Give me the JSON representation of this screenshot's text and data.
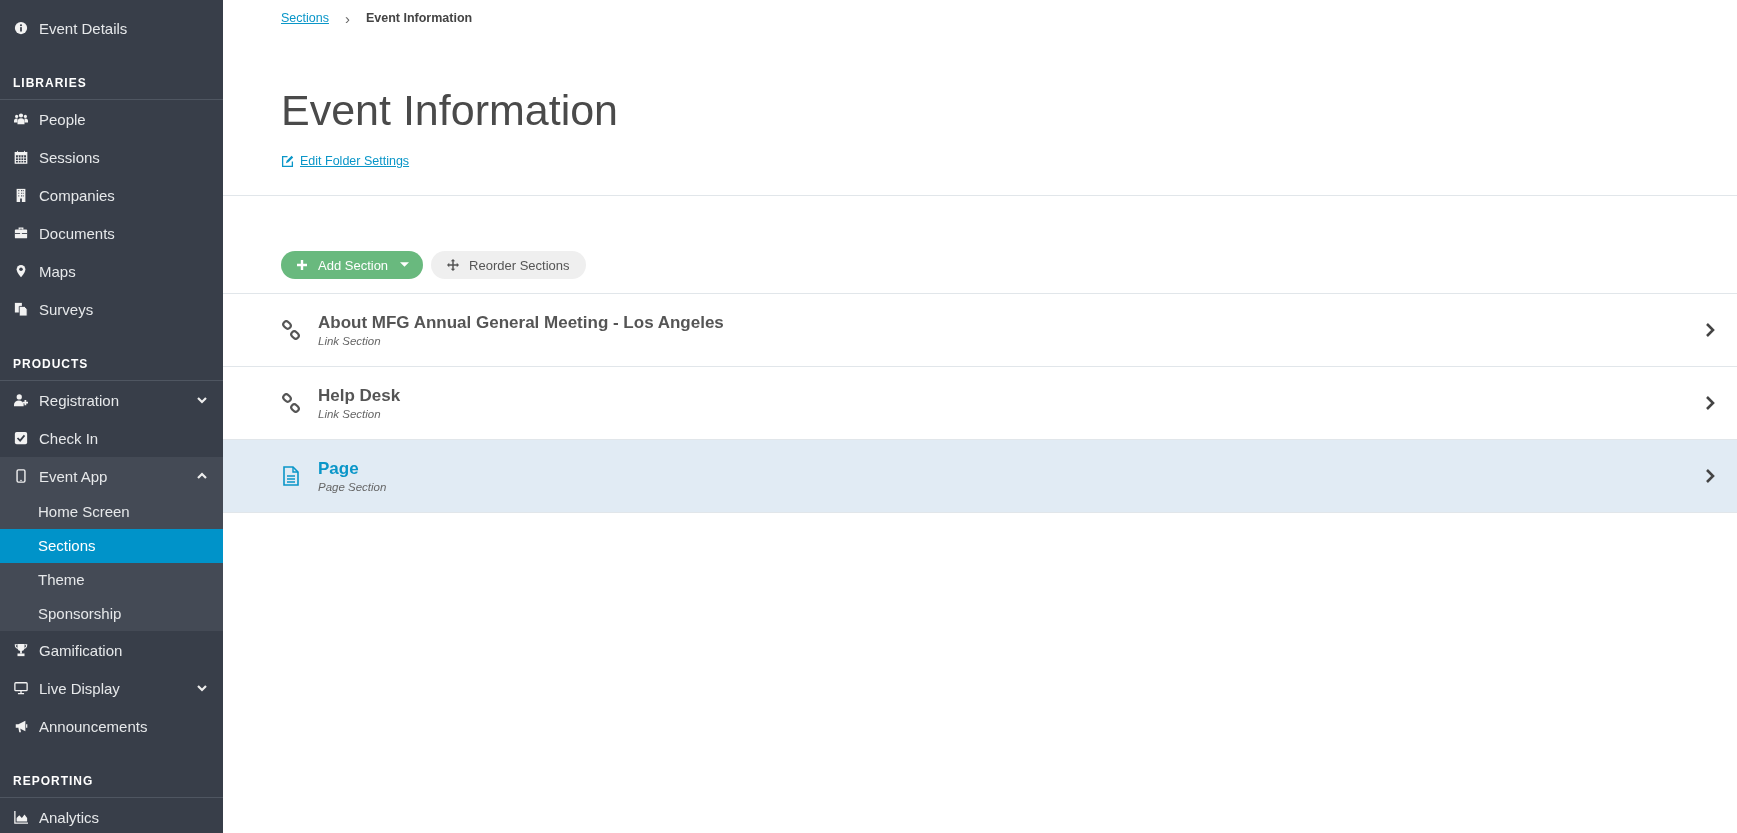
{
  "sidebar": {
    "groups": [
      {
        "items": [
          {
            "label": "Event Details",
            "selected": false
          }
        ]
      },
      {
        "header": "LIBRARIES",
        "items": [
          {
            "label": "People",
            "selected": false
          },
          {
            "label": "Sessions",
            "selected": false
          },
          {
            "label": "Companies",
            "selected": false
          },
          {
            "label": "Documents",
            "selected": false
          },
          {
            "label": "Maps",
            "selected": false
          },
          {
            "label": "Surveys",
            "selected": false
          }
        ]
      },
      {
        "header": "PRODUCTS",
        "items": [
          {
            "label": "Registration",
            "selected": false,
            "expanded": false
          },
          {
            "label": "Check In",
            "selected": false
          },
          {
            "label": "Event App",
            "selected": false,
            "expanded": true,
            "children": [
              {
                "label": "Home Screen",
                "selected": false
              },
              {
                "label": "Sections",
                "selected": true
              },
              {
                "label": "Theme",
                "selected": false
              },
              {
                "label": "Sponsorship",
                "selected": false
              }
            ]
          },
          {
            "label": "Gamification",
            "selected": false
          },
          {
            "label": "Live Display",
            "selected": false,
            "expanded": false
          },
          {
            "label": "Announcements",
            "selected": false
          }
        ]
      },
      {
        "header": "REPORTING",
        "items": [
          {
            "label": "Analytics",
            "selected": false
          }
        ]
      }
    ]
  },
  "breadcrumb": {
    "link": "Sections",
    "separator": "›",
    "current": "Event Information"
  },
  "title": "Event Information",
  "edit_link": "Edit Folder Settings",
  "buttons": {
    "add": "Add Section",
    "reorder": "Reorder Sections"
  },
  "rows": [
    {
      "kind": "link",
      "title": "About MFG Annual General Meeting - Los Angeles",
      "subtitle": "Link Section",
      "highlighted": false
    },
    {
      "kind": "link",
      "title": "Help Desk",
      "subtitle": "Link Section",
      "highlighted": false
    },
    {
      "kind": "page",
      "title": "Page",
      "subtitle": "Page Section",
      "highlighted": true
    }
  ]
}
